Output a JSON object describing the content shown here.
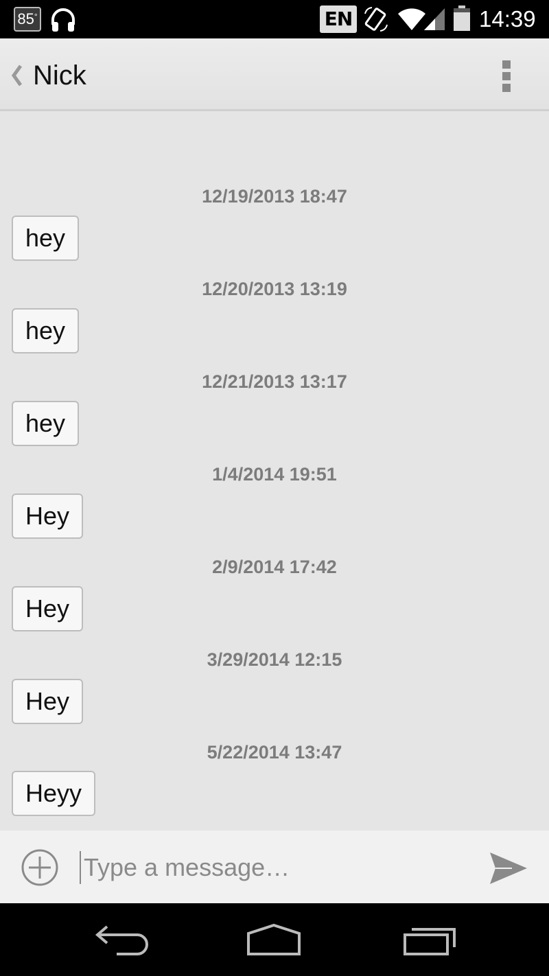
{
  "status_bar": {
    "temperature": "85",
    "degree_symbol": "°",
    "language": "EN",
    "time": "14:39"
  },
  "action_bar": {
    "contact_name": "Nick"
  },
  "messages": [
    {
      "timestamp": "12/19/2013 18:47",
      "text": "hey"
    },
    {
      "timestamp": "12/20/2013 13:19",
      "text": "hey"
    },
    {
      "timestamp": "12/21/2013 13:17",
      "text": "hey"
    },
    {
      "timestamp": "1/4/2014 19:51",
      "text": "Hey"
    },
    {
      "timestamp": "2/9/2014 17:42",
      "text": "Hey"
    },
    {
      "timestamp": "3/29/2014 12:15",
      "text": "Hey"
    },
    {
      "timestamp": "5/22/2014 13:47",
      "text": "Heyy"
    }
  ],
  "compose": {
    "placeholder": "Type a message…",
    "value": ""
  },
  "icons": {
    "status": [
      "headphones-icon",
      "rotate-icon",
      "wifi-icon",
      "signal-icon",
      "battery-icon"
    ],
    "action_bar": [
      "chevron-left-icon",
      "overflow-menu-icon"
    ],
    "compose": [
      "add-attachment-icon",
      "send-icon"
    ],
    "navigation": [
      "back-icon",
      "home-icon",
      "recents-icon"
    ]
  },
  "colors": {
    "status_bar": "#000000",
    "background": "#e5e5e5",
    "timestamp": "#7c7c7c",
    "bubble": "#f7f7f7",
    "bubble_border": "#bdbdbd",
    "send": "#8a8a8a"
  }
}
